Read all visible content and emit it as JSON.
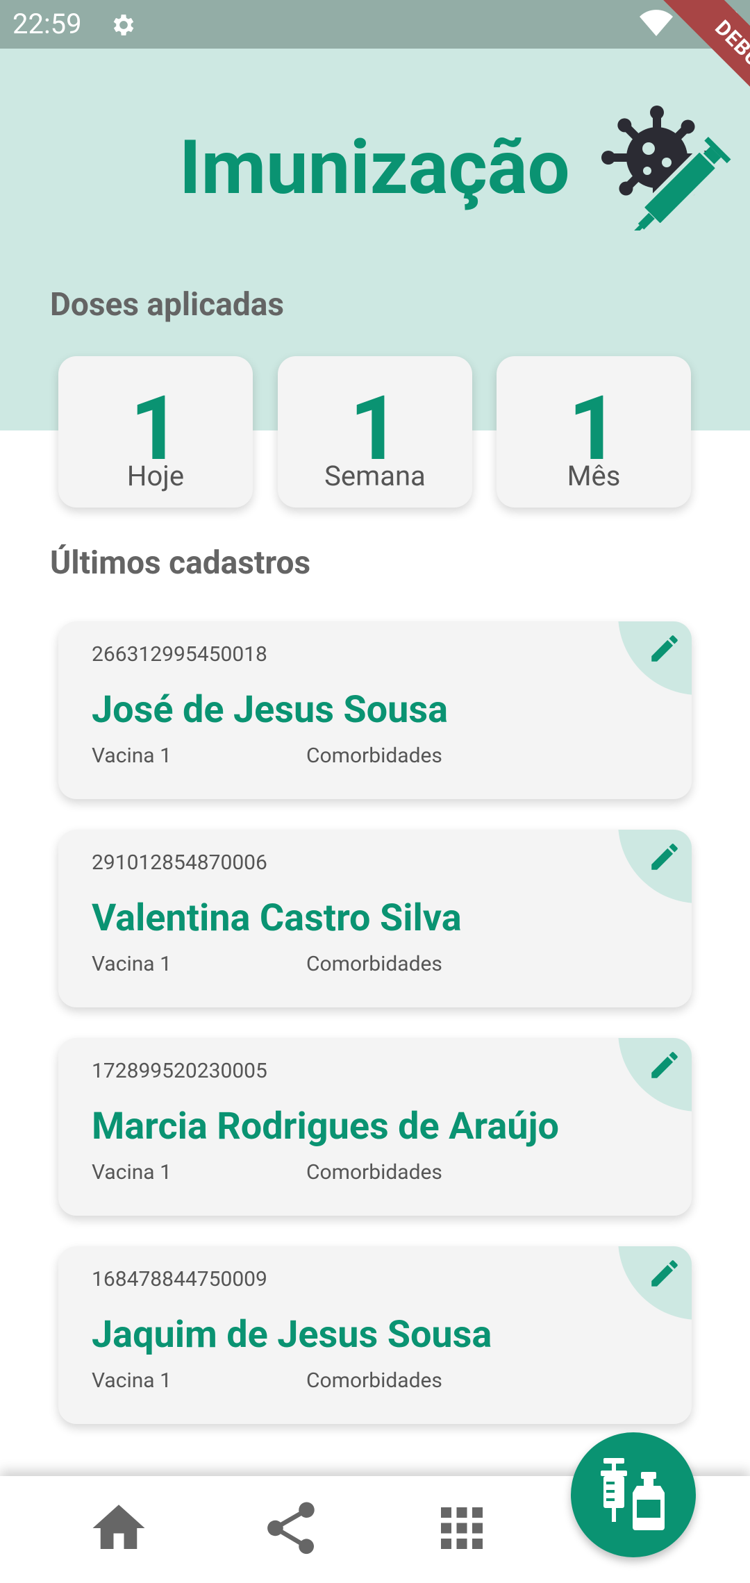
{
  "status_bar": {
    "time": "22:59"
  },
  "debug_label": "DEBUG",
  "header": {
    "title": "Imunização",
    "logo_icon": "virus-syringe-icon"
  },
  "doses": {
    "title": "Doses aplicadas",
    "cards": [
      {
        "value": "1",
        "label": "Hoje"
      },
      {
        "value": "1",
        "label": "Semana"
      },
      {
        "value": "1",
        "label": "Mês"
      }
    ]
  },
  "records": {
    "title": "Últimos cadastros",
    "items": [
      {
        "id": "266312995450018",
        "name": "José de Jesus Sousa",
        "vaccine": "Vacina 1",
        "comorbidity": "Comorbidades"
      },
      {
        "id": "291012854870006",
        "name": "Valentina Castro Silva",
        "vaccine": "Vacina 1",
        "comorbidity": "Comorbidades"
      },
      {
        "id": "172899520230005",
        "name": "Marcia Rodrigues de Araújo",
        "vaccine": "Vacina 1",
        "comorbidity": "Comorbidades"
      },
      {
        "id": "168478844750009",
        "name": "Jaquim de Jesus Sousa",
        "vaccine": "Vacina 1",
        "comorbidity": "Comorbidades"
      }
    ]
  },
  "nav": {
    "items": [
      {
        "icon": "home-icon"
      },
      {
        "icon": "share-icon"
      },
      {
        "icon": "grid-icon"
      }
    ],
    "fab_icon": "vaccine-vial-icon"
  },
  "colors": {
    "primary": "#0a9372",
    "header_bg": "#cde8e2",
    "status_bar": "#93ada6",
    "card_bg": "#f4f4f4"
  }
}
